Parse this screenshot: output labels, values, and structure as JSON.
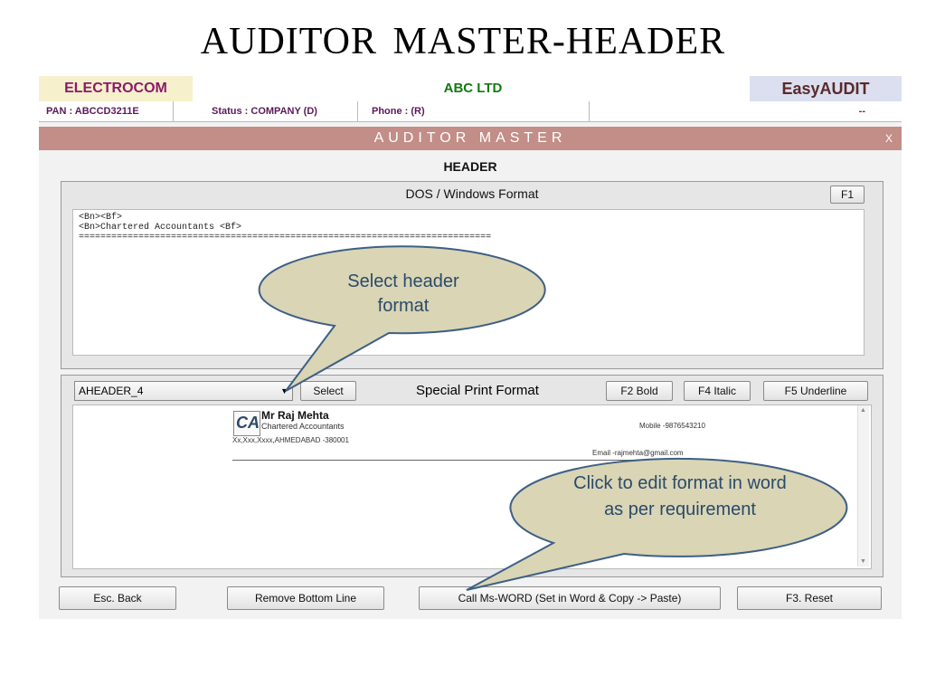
{
  "slide_title": "AUDITOR  MASTER-HEADER",
  "topbar": {
    "brand": "ELECTROCOM",
    "company": "ABC LTD",
    "product": "EasyAUDIT"
  },
  "infobar": {
    "pan": "PAN : ABCCD3211E",
    "status": "Status : COMPANY (D)",
    "phone": "Phone : (R)",
    "right": "--"
  },
  "window": {
    "title": "AUDITOR MASTER",
    "close": "X",
    "section": "HEADER"
  },
  "dos_panel": {
    "title": "DOS / Windows Format",
    "f1_label": "F1",
    "lines": [
      "<Bn><Bf>",
      "<Bn>Chartered Accountants <Bf>",
      "============================================================================"
    ]
  },
  "print_panel": {
    "dropdown_value": "AHEADER_4",
    "select_label": "Select",
    "title": "Special Print Format",
    "bold_label": "F2 Bold",
    "italic_label": "F4 Italic",
    "underline_label": "F5 Underline",
    "letterhead": {
      "logo": "CA",
      "name": "Mr Raj Mehta",
      "designation": "Chartered Accountants",
      "address": "Xx,Xxx,Xxxx,AHMEDABAD -380001",
      "mobile": "Mobile -9876543210",
      "email": "Email -rajmehta@gmail.com"
    }
  },
  "footer": {
    "back_label": "Esc. Back",
    "remove_label": "Remove Bottom Line",
    "word_label": "Call Ms-WORD (Set in Word & Copy -> Paste)",
    "reset_label": "F3. Reset"
  },
  "callouts": {
    "select_header": "Select header format",
    "edit_word": "Click to edit format in word as per requirement"
  },
  "colors": {
    "titlebar": "#c28e87",
    "callout_fill": "#d9d5b5",
    "callout_stroke": "#3e5f85",
    "callout_text": "#2b4a6a"
  }
}
